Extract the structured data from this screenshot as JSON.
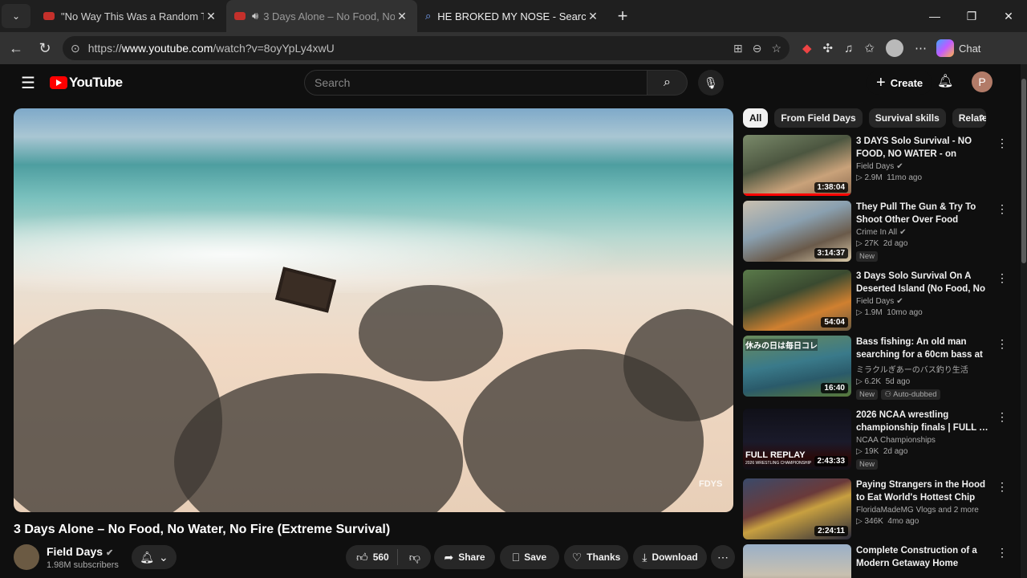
{
  "browser": {
    "tabs": [
      {
        "title": "\"No Way This Was a Random Traffi",
        "active": false
      },
      {
        "title": "3 Days Alone – No Food, No W",
        "active": true
      },
      {
        "title": "HE BROKED MY NOSE - Search",
        "active": false
      }
    ],
    "url_prefix": "https://",
    "url_host": "www.youtube.com",
    "url_path": "/watch?v=8oyYpLy4xwU",
    "chat_label": "Chat"
  },
  "youtube": {
    "logo_text": "YouTube",
    "search_placeholder": "Search",
    "create_label": "Create",
    "avatar_letter": "P",
    "video": {
      "title": "3 Days Alone – No Food, No Water, No Fire (Extreme Survival)",
      "watermark": "FDYS",
      "channel": "Field Days",
      "subscribers": "1.98M subscribers",
      "likes": "560",
      "share_label": "Share",
      "save_label": "Save",
      "thanks_label": "Thanks",
      "download_label": "Download"
    },
    "chips": [
      "All",
      "From Field Days",
      "Survival skills",
      "Relate"
    ],
    "recommendations": [
      {
        "title": "3 DAYS Solo Survival - NO FOOD, NO WATER - on Remote…",
        "channel": "Field Days",
        "verified": true,
        "views": "2.9M",
        "age": "11mo ago",
        "duration": "1:38:04",
        "badges": [],
        "watched": true
      },
      {
        "title": "They Pull The Gun & Try To Shoot  Other Over Food",
        "channel": "Crime In All",
        "verified": true,
        "views": "27K",
        "age": "2d ago",
        "duration": "3:14:37",
        "badges": [
          "New"
        ],
        "watched": false
      },
      {
        "title": "3 Days Solo Survival On A Deserted Island (No Food, No …",
        "channel": "Field Days",
        "verified": true,
        "views": "1.9M",
        "age": "10mo ago",
        "duration": "54:04",
        "badges": [],
        "watched": false
      },
      {
        "title": "Bass fishing: An old man searching for a 60cm bass at …",
        "channel": "ミラクルぎあーのバス釣り生活",
        "verified": false,
        "views": "6.2K",
        "age": "5d ago",
        "duration": "16:40",
        "badges": [
          "New",
          "Auto-dubbed"
        ],
        "watched": false,
        "thumb_text": "休みの日は毎日コレ"
      },
      {
        "title": "2026 NCAA wrestling championship finals | FULL …",
        "channel": "NCAA Championships",
        "verified": false,
        "views": "19K",
        "age": "2d ago",
        "duration": "2:43:33",
        "badges": [
          "New"
        ],
        "watched": false,
        "thumb_text": "FULL REPLAY",
        "thumb_subtext": "2026 WRESTLING CHAMPIONSHIP"
      },
      {
        "title": "Paying Strangers in the Hood to Eat World's Hottest Chip Ever! …",
        "channel": "FloridaMadeMG Vlogs and 2 more",
        "verified": false,
        "views": "346K",
        "age": "4mo ago",
        "duration": "2:24:11",
        "badges": [],
        "watched": false
      },
      {
        "title": "Complete Construction of a Modern Getaway Home",
        "channel": "",
        "verified": false,
        "views": "",
        "age": "",
        "duration": "",
        "badges": [],
        "watched": false
      }
    ]
  }
}
